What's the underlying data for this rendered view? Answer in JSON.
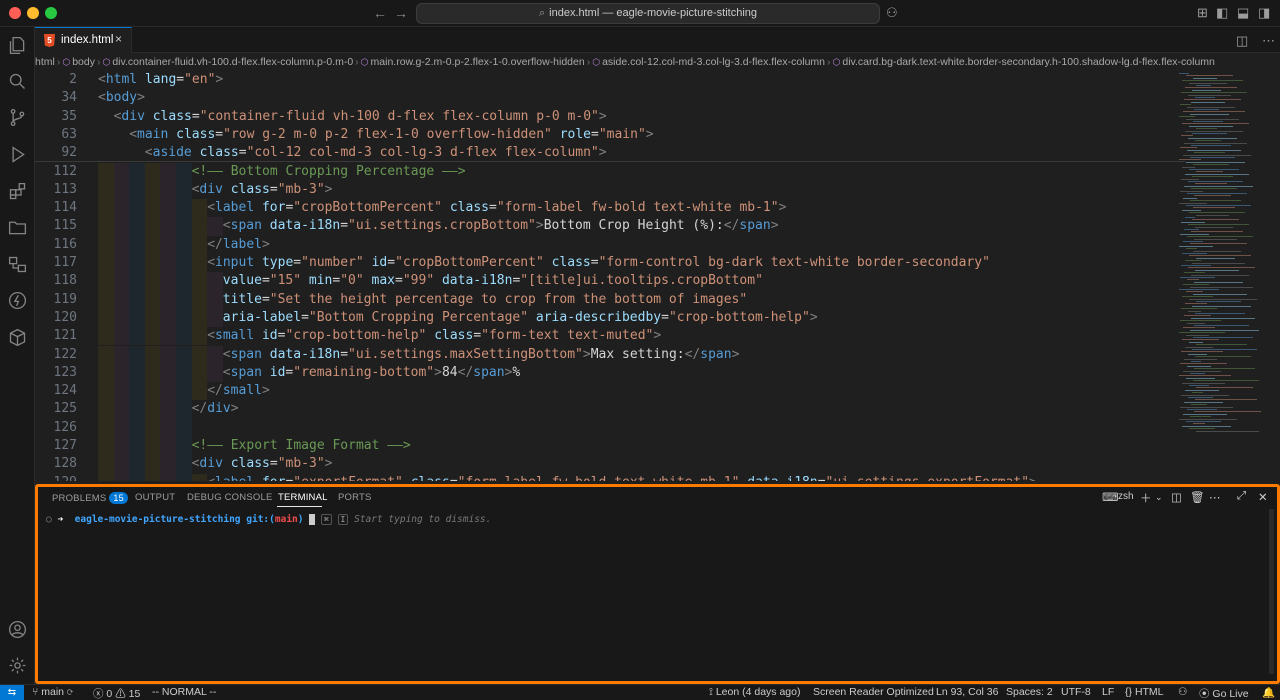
{
  "window": {
    "title": "index.html — eagle-movie-picture-stitching"
  },
  "tab": {
    "label": "index.html",
    "close": "×"
  },
  "breadcrumbs": [
    "html",
    "body",
    "div.container-fluid.vh-100.d-flex.flex-column.p-0.m-0",
    "main.row.g-2.m-0.p-2.flex-1-0.overflow-hidden",
    "aside.col-12.col-md-3.col-lg-3.d-flex.flex-column",
    "div.card.bg-dark.text-white.border-secondary.h-100.shadow-lg.d-flex.flex-column"
  ],
  "editor": {
    "sticky_lines": [
      {
        "num": "2",
        "indent": 0,
        "parts": [
          [
            "br",
            "<"
          ],
          [
            "tag",
            "html"
          ],
          [
            "tx",
            " "
          ],
          [
            "at",
            "lang"
          ],
          [
            "tx",
            "="
          ],
          [
            "st",
            "\"en\""
          ],
          [
            "br",
            ">"
          ]
        ]
      },
      {
        "num": "34",
        "indent": 0,
        "parts": [
          [
            "br",
            "<"
          ],
          [
            "tag",
            "body"
          ],
          [
            "br",
            ">"
          ]
        ]
      },
      {
        "num": "35",
        "indent": 2,
        "parts": [
          [
            "br",
            "<"
          ],
          [
            "tag",
            "div"
          ],
          [
            "tx",
            " "
          ],
          [
            "at",
            "class"
          ],
          [
            "tx",
            "="
          ],
          [
            "st",
            "\"container-fluid vh-100 d-flex flex-column p-0 m-0\""
          ],
          [
            "br",
            ">"
          ]
        ]
      },
      {
        "num": "63",
        "indent": 4,
        "parts": [
          [
            "br",
            "<"
          ],
          [
            "tag",
            "main"
          ],
          [
            "tx",
            " "
          ],
          [
            "at",
            "class"
          ],
          [
            "tx",
            "="
          ],
          [
            "st",
            "\"row g-2 m-0 p-2 flex-1-0 overflow-hidden\""
          ],
          [
            "tx",
            " "
          ],
          [
            "at",
            "role"
          ],
          [
            "tx",
            "="
          ],
          [
            "st",
            "\"main\""
          ],
          [
            "br",
            ">"
          ]
        ]
      },
      {
        "num": "92",
        "indent": 6,
        "parts": [
          [
            "br",
            "<"
          ],
          [
            "tag",
            "aside"
          ],
          [
            "tx",
            " "
          ],
          [
            "at",
            "class"
          ],
          [
            "tx",
            "="
          ],
          [
            "st",
            "\"col-12 col-md-3 col-lg-3 d-flex flex-column\""
          ],
          [
            "br",
            ">"
          ]
        ]
      }
    ],
    "lines": [
      {
        "num": "112",
        "indent": 12,
        "parts": [
          [
            "cm",
            "<!—— Bottom Cropping Percentage ——>"
          ]
        ]
      },
      {
        "num": "113",
        "indent": 12,
        "parts": [
          [
            "br",
            "<"
          ],
          [
            "tag",
            "div"
          ],
          [
            "tx",
            " "
          ],
          [
            "at",
            "class"
          ],
          [
            "tx",
            "="
          ],
          [
            "st",
            "\"mb-3\""
          ],
          [
            "br",
            ">"
          ]
        ]
      },
      {
        "num": "114",
        "indent": 14,
        "parts": [
          [
            "br",
            "<"
          ],
          [
            "tag",
            "label"
          ],
          [
            "tx",
            " "
          ],
          [
            "at",
            "for"
          ],
          [
            "tx",
            "="
          ],
          [
            "st",
            "\"cropBottomPercent\""
          ],
          [
            "tx",
            " "
          ],
          [
            "at",
            "class"
          ],
          [
            "tx",
            "="
          ],
          [
            "st",
            "\"form-label fw-bold text-white mb-1\""
          ],
          [
            "br",
            ">"
          ]
        ]
      },
      {
        "num": "115",
        "indent": 16,
        "parts": [
          [
            "br",
            "<"
          ],
          [
            "tag",
            "span"
          ],
          [
            "tx",
            " "
          ],
          [
            "at",
            "data-i18n"
          ],
          [
            "tx",
            "="
          ],
          [
            "st",
            "\"ui.settings.cropBottom\""
          ],
          [
            "br",
            ">"
          ],
          [
            "tx",
            "Bottom Crop Height (%):"
          ],
          [
            "br",
            "</"
          ],
          [
            "tag",
            "span"
          ],
          [
            "br",
            ">"
          ]
        ]
      },
      {
        "num": "116",
        "indent": 14,
        "parts": [
          [
            "br",
            "</"
          ],
          [
            "tag",
            "label"
          ],
          [
            "br",
            ">"
          ]
        ]
      },
      {
        "num": "117",
        "indent": 14,
        "parts": [
          [
            "br",
            "<"
          ],
          [
            "tag",
            "input"
          ],
          [
            "tx",
            " "
          ],
          [
            "at",
            "type"
          ],
          [
            "tx",
            "="
          ],
          [
            "st",
            "\"number\""
          ],
          [
            "tx",
            " "
          ],
          [
            "at",
            "id"
          ],
          [
            "tx",
            "="
          ],
          [
            "st",
            "\"cropBottomPercent\""
          ],
          [
            "tx",
            " "
          ],
          [
            "at",
            "class"
          ],
          [
            "tx",
            "="
          ],
          [
            "st",
            "\"form-control bg-dark text-white border-secondary\""
          ]
        ]
      },
      {
        "num": "118",
        "indent": 16,
        "parts": [
          [
            "at",
            "value"
          ],
          [
            "tx",
            "="
          ],
          [
            "st",
            "\"15\""
          ],
          [
            "tx",
            " "
          ],
          [
            "at",
            "min"
          ],
          [
            "tx",
            "="
          ],
          [
            "st",
            "\"0\""
          ],
          [
            "tx",
            " "
          ],
          [
            "at",
            "max"
          ],
          [
            "tx",
            "="
          ],
          [
            "st",
            "\"99\""
          ],
          [
            "tx",
            " "
          ],
          [
            "at",
            "data-i18n"
          ],
          [
            "tx",
            "="
          ],
          [
            "st",
            "\"[title]ui.tooltips.cropBottom\""
          ]
        ]
      },
      {
        "num": "119",
        "indent": 16,
        "parts": [
          [
            "at",
            "title"
          ],
          [
            "tx",
            "="
          ],
          [
            "st",
            "\"Set the height percentage to crop from the bottom of images\""
          ]
        ]
      },
      {
        "num": "120",
        "indent": 16,
        "parts": [
          [
            "at",
            "aria-label"
          ],
          [
            "tx",
            "="
          ],
          [
            "st",
            "\"Bottom Cropping Percentage\""
          ],
          [
            "tx",
            " "
          ],
          [
            "at",
            "aria-describedby"
          ],
          [
            "tx",
            "="
          ],
          [
            "st",
            "\"crop-bottom-help\""
          ],
          [
            "br",
            ">"
          ]
        ]
      },
      {
        "num": "121",
        "indent": 14,
        "parts": [
          [
            "br",
            "<"
          ],
          [
            "tag",
            "small"
          ],
          [
            "tx",
            " "
          ],
          [
            "at",
            "id"
          ],
          [
            "tx",
            "="
          ],
          [
            "st",
            "\"crop-bottom-help\""
          ],
          [
            "tx",
            " "
          ],
          [
            "at",
            "class"
          ],
          [
            "tx",
            "="
          ],
          [
            "st",
            "\"form-text text-muted\""
          ],
          [
            "br",
            ">"
          ]
        ]
      },
      {
        "num": "122",
        "indent": 16,
        "parts": [
          [
            "br",
            "<"
          ],
          [
            "tag",
            "span"
          ],
          [
            "tx",
            " "
          ],
          [
            "at",
            "data-i18n"
          ],
          [
            "tx",
            "="
          ],
          [
            "st",
            "\"ui.settings.maxSettingBottom\""
          ],
          [
            "br",
            ">"
          ],
          [
            "tx",
            "Max setting:"
          ],
          [
            "br",
            "</"
          ],
          [
            "tag",
            "span"
          ],
          [
            "br",
            ">"
          ]
        ]
      },
      {
        "num": "123",
        "indent": 16,
        "parts": [
          [
            "br",
            "<"
          ],
          [
            "tag",
            "span"
          ],
          [
            "tx",
            " "
          ],
          [
            "at",
            "id"
          ],
          [
            "tx",
            "="
          ],
          [
            "st",
            "\"remaining-bottom\""
          ],
          [
            "br",
            ">"
          ],
          [
            "tx",
            "84"
          ],
          [
            "br",
            "</"
          ],
          [
            "tag",
            "span"
          ],
          [
            "br",
            ">"
          ],
          [
            "tx",
            "%"
          ]
        ]
      },
      {
        "num": "124",
        "indent": 14,
        "parts": [
          [
            "br",
            "</"
          ],
          [
            "tag",
            "small"
          ],
          [
            "br",
            ">"
          ]
        ]
      },
      {
        "num": "125",
        "indent": 12,
        "parts": [
          [
            "br",
            "</"
          ],
          [
            "tag",
            "div"
          ],
          [
            "br",
            ">"
          ]
        ]
      },
      {
        "num": "126",
        "indent": 12,
        "parts": []
      },
      {
        "num": "127",
        "indent": 12,
        "parts": [
          [
            "cm",
            "<!—— Export Image Format ——>"
          ]
        ]
      },
      {
        "num": "128",
        "indent": 12,
        "parts": [
          [
            "br",
            "<"
          ],
          [
            "tag",
            "div"
          ],
          [
            "tx",
            " "
          ],
          [
            "at",
            "class"
          ],
          [
            "tx",
            "="
          ],
          [
            "st",
            "\"mb-3\""
          ],
          [
            "br",
            ">"
          ]
        ]
      },
      {
        "num": "129",
        "indent": 14,
        "parts": [
          [
            "br",
            "<"
          ],
          [
            "tag",
            "label"
          ],
          [
            "tx",
            " "
          ],
          [
            "at",
            "for"
          ],
          [
            "tx",
            "="
          ],
          [
            "st",
            "\"exportFormat\""
          ],
          [
            "tx",
            " "
          ],
          [
            "at",
            "class"
          ],
          [
            "tx",
            "="
          ],
          [
            "st",
            "\"form-label fw-bold text-white mb-1\""
          ],
          [
            "tx",
            " "
          ],
          [
            "at",
            "data-i18n"
          ],
          [
            "tx",
            "="
          ],
          [
            "st",
            "\"ui.settings.exportFormat\""
          ],
          [
            "br",
            ">"
          ]
        ]
      }
    ]
  },
  "panel": {
    "tabs": [
      {
        "label": "PROBLEMS",
        "badge": "15"
      },
      {
        "label": "OUTPUT"
      },
      {
        "label": "DEBUG CONSOLE"
      },
      {
        "label": "TERMINAL",
        "active": true
      },
      {
        "label": "PORTS"
      }
    ],
    "shell": "zsh",
    "terminal": {
      "prompt_arrow": "➜",
      "directory": "eagle-movie-picture-stitching",
      "git_label": "git:(",
      "branch": "main",
      "git_close": ")",
      "hint": "Start typing to dismiss.",
      "kbd1": "⌘",
      "kbd2": "I"
    }
  },
  "status": {
    "remote_icon": "⇆",
    "branch": "main",
    "errors": "0",
    "warnings": "15",
    "mode": "-- NORMAL --",
    "blame": "Leon (4 days ago)",
    "screen_reader": "Screen Reader Optimized",
    "position": "Ln 93, Col 36",
    "spaces": "Spaces: 2",
    "encoding": "UTF-8",
    "eol": "LF",
    "language": "HTML",
    "golive": "Go Live"
  },
  "colors": {
    "accent": "#0078d4",
    "highlight_border": "#ff7b00"
  }
}
